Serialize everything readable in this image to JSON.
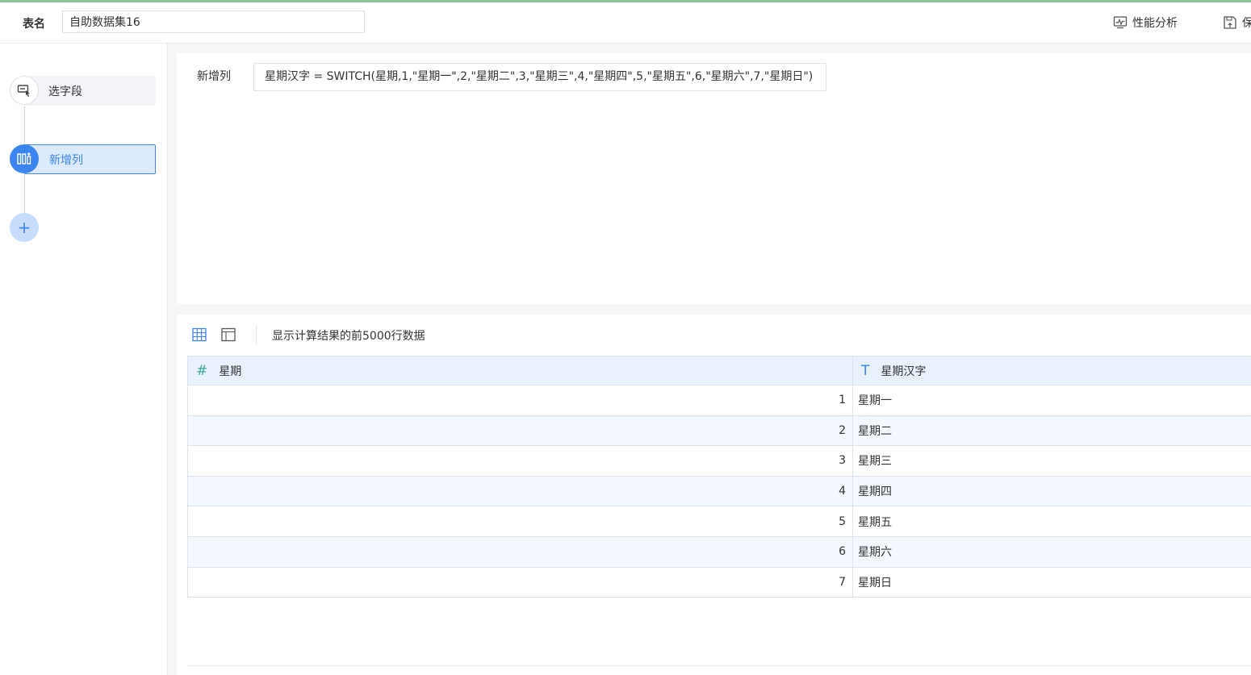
{
  "header": {
    "table_name_label": "表名",
    "table_name_value": "自助数据集16",
    "perf_label": "性能分析",
    "save_label": "保"
  },
  "sidebar": {
    "steps": [
      {
        "label": "选字段",
        "icon": "select-field-icon"
      },
      {
        "label": "新增列",
        "icon": "add-column-icon",
        "active": true
      }
    ],
    "add_symbol": "+"
  },
  "formula": {
    "label": "新增列",
    "expression": "星期汉字 = SWITCH(星期,1,\"星期一\",2,\"星期二\",3,\"星期三\",4,\"星期四\",5,\"星期五\",6,\"星期六\",7,\"星期日\")"
  },
  "preview": {
    "note": "显示计算结果的前5000行数据",
    "columns": [
      {
        "type_icon": "#",
        "name": "星期"
      },
      {
        "type_icon": "T",
        "name": "星期汉字"
      }
    ],
    "rows": [
      [
        "1",
        "星期一"
      ],
      [
        "2",
        "星期二"
      ],
      [
        "3",
        "星期三"
      ],
      [
        "4",
        "星期四"
      ],
      [
        "5",
        "星期五"
      ],
      [
        "6",
        "星期六"
      ],
      [
        "7",
        "星期日"
      ]
    ]
  },
  "colors": {
    "accent": "#3c84ef",
    "header_bg": "#e8f1fd",
    "alt_row_bg": "#f3f8fe",
    "number_icon": "#3aa89a"
  }
}
